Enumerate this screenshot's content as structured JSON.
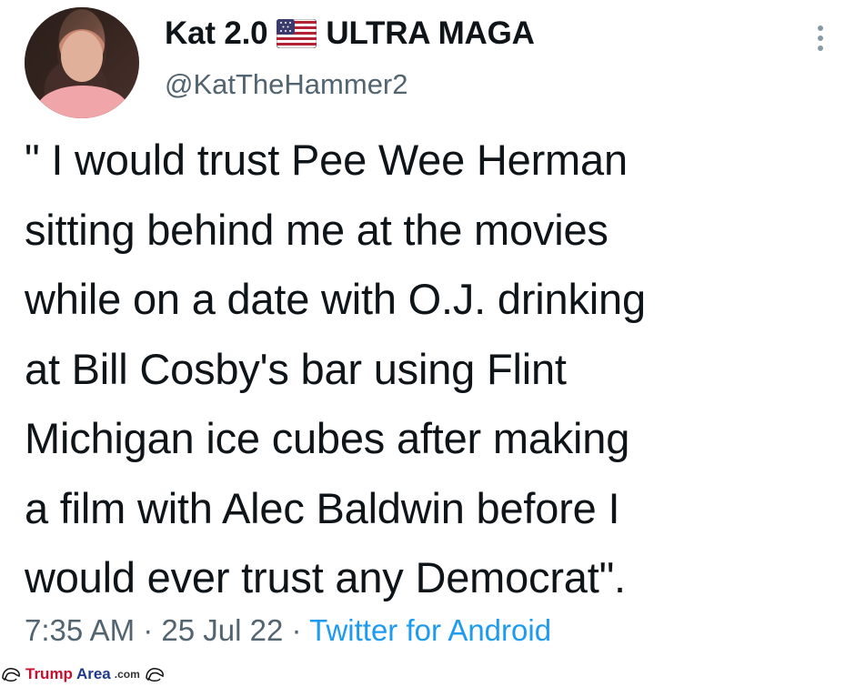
{
  "tweet": {
    "display_name": "Kat 2.0",
    "name_suffix": "ULTRA MAGA",
    "flag_icon": "us-flag-icon",
    "handle": "@KatTheHammer2",
    "text": "\" I would trust Pee Wee Herman\nsitting behind me at the movies\nwhile on a date with O.J. drinking\nat Bill Cosby's bar using Flint\nMichigan  ice cubes after making\na film with Alec Baldwin before I\nwould ever trust any Democrat\".",
    "time": "7:35 AM",
    "separator": "·",
    "date": "25 Jul 22",
    "source": "Twitter for Android"
  },
  "watermark": {
    "part1": "Trump",
    "part2": "Area",
    "suffix": ".com",
    "icon": "trump-hair-icon"
  },
  "colors": {
    "text": "#0f1419",
    "secondary": "#536471",
    "link": "#1d9bf0",
    "watermark_red": "#c8102e",
    "watermark_blue": "#1f3a8a"
  }
}
